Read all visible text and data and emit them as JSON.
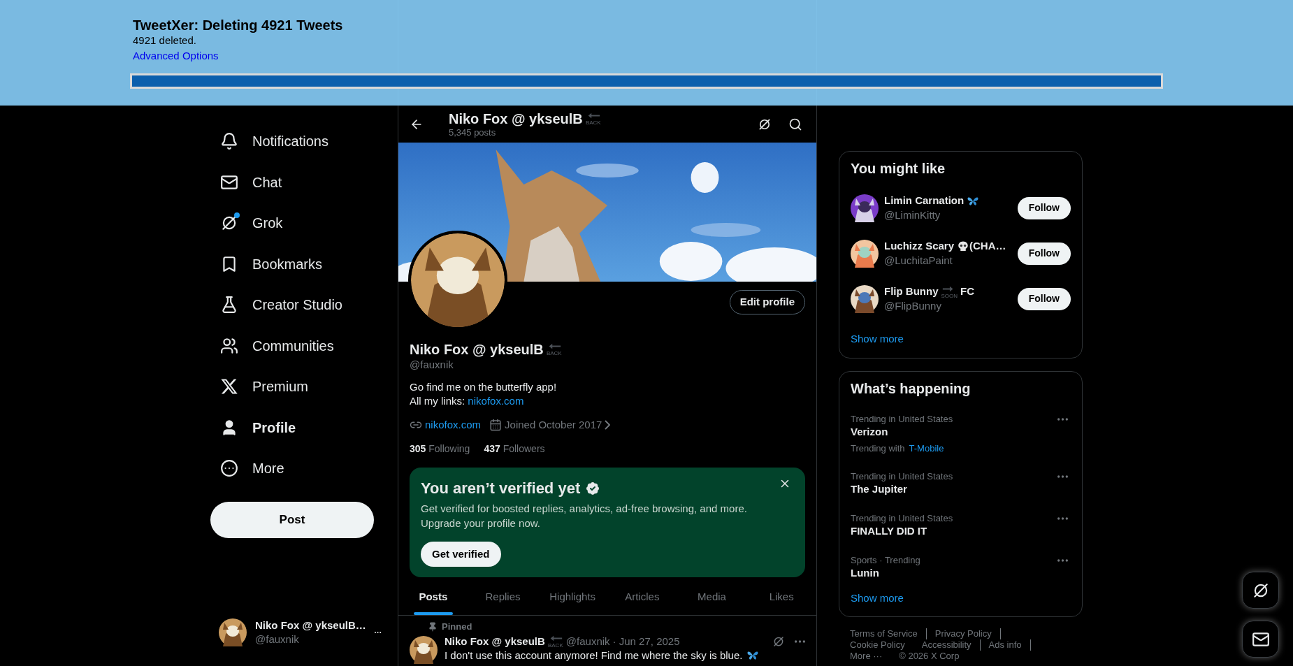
{
  "overlay": {
    "title": "TweetXer: Deleting 4921 Tweets",
    "status": "4921 deleted.",
    "link": "Advanced Options",
    "progress": {
      "level": 1
    }
  },
  "nav": {
    "items": [
      {
        "label": "Notifications",
        "selected": false,
        "unread": false
      },
      {
        "label": "Chat",
        "selected": false,
        "unread": false
      },
      {
        "label": "Grok",
        "selected": false,
        "unread": true
      },
      {
        "label": "Bookmarks",
        "selected": false,
        "unread": false
      },
      {
        "label": "Creator Studio",
        "selected": false,
        "unread": false
      },
      {
        "label": "Communities",
        "selected": false,
        "unread": false
      },
      {
        "label": "Premium",
        "selected": false,
        "unread": false
      },
      {
        "label": "Profile",
        "selected": true,
        "unread": false
      },
      {
        "label": "More",
        "selected": false,
        "unread": false
      }
    ],
    "post_button": "Post",
    "account": {
      "name": "Niko Fox @ ykseulB…",
      "handle": "@fauxnik"
    }
  },
  "header": {
    "name": "Niko Fox @ ykseulB",
    "badge": {
      "text": "BACK",
      "kind": "left"
    },
    "count": "5,345 posts"
  },
  "profile": {
    "edit_button": "Edit profile",
    "name": "Niko Fox @ ykseulB",
    "badge": {
      "text": "BACK",
      "kind": "left"
    },
    "handle": "@fauxnik",
    "bio": {
      "line": "Go find me on the butterfly app!",
      "links_label": "All my links:",
      "link": "nikofox.com"
    },
    "website": "nikofox.com",
    "joined": "Joined October 2017",
    "following": {
      "count": "305",
      "label": "Following"
    },
    "followers": {
      "count": "437",
      "label": "Followers"
    }
  },
  "verify_card": {
    "title": "You aren’t verified yet",
    "body": [
      "Get verified for boosted replies, analytics, ad-free browsing, and more.",
      "Upgrade your profile now."
    ],
    "button": "Get verified"
  },
  "tabs": [
    {
      "label": "Posts",
      "selected": true
    },
    {
      "label": "Replies",
      "selected": false
    },
    {
      "label": "Highlights",
      "selected": false
    },
    {
      "label": "Articles",
      "selected": false
    },
    {
      "label": "Media",
      "selected": false
    },
    {
      "label": "Likes",
      "selected": false
    }
  ],
  "pinned_post": {
    "pinned_label": "Pinned",
    "name": "Niko Fox @ ykseulB",
    "badge": {
      "text": "BACK",
      "kind": "left"
    },
    "handle": "@fauxnik",
    "date": "· Jun 27, 2025",
    "text": "I don't use this account anymore! Find me where the sky is blue."
  },
  "who_to_follow": {
    "title": "You might like",
    "users": [
      {
        "name": "Limin Carnation",
        "kind": "butterfly",
        "handle": "@LiminKitty",
        "button": "Follow"
      },
      {
        "name": "Luchizz Scary",
        "kind": "skull",
        "suffix": "(CHA…",
        "handle": "@LuchitaPaint",
        "button": "Follow"
      },
      {
        "name": "Flip Bunny",
        "kind": "badge",
        "badge": {
          "text": "SOON",
          "kind": "right"
        },
        "suffix": "FC",
        "handle": "@FlipBunny",
        "button": "Follow"
      }
    ],
    "show_more": "Show more"
  },
  "trends": {
    "title": "What’s happening",
    "items": [
      {
        "context": "Trending in United States",
        "topic": "Verizon",
        "related_label": "Trending with",
        "related": "T-Mobile"
      },
      {
        "context": "Trending in United States",
        "topic": "The Jupiter"
      },
      {
        "context": "Trending in United States",
        "topic": "FINALLY DID IT"
      },
      {
        "context": "Sports · Trending",
        "topic": "Lunin"
      }
    ],
    "show_more": "Show more"
  },
  "footer": [
    "Terms of Service",
    "Privacy Policy",
    "Cookie Policy",
    "Accessibility",
    "Ads info",
    "More ···",
    "© 2026 X Corp"
  ]
}
